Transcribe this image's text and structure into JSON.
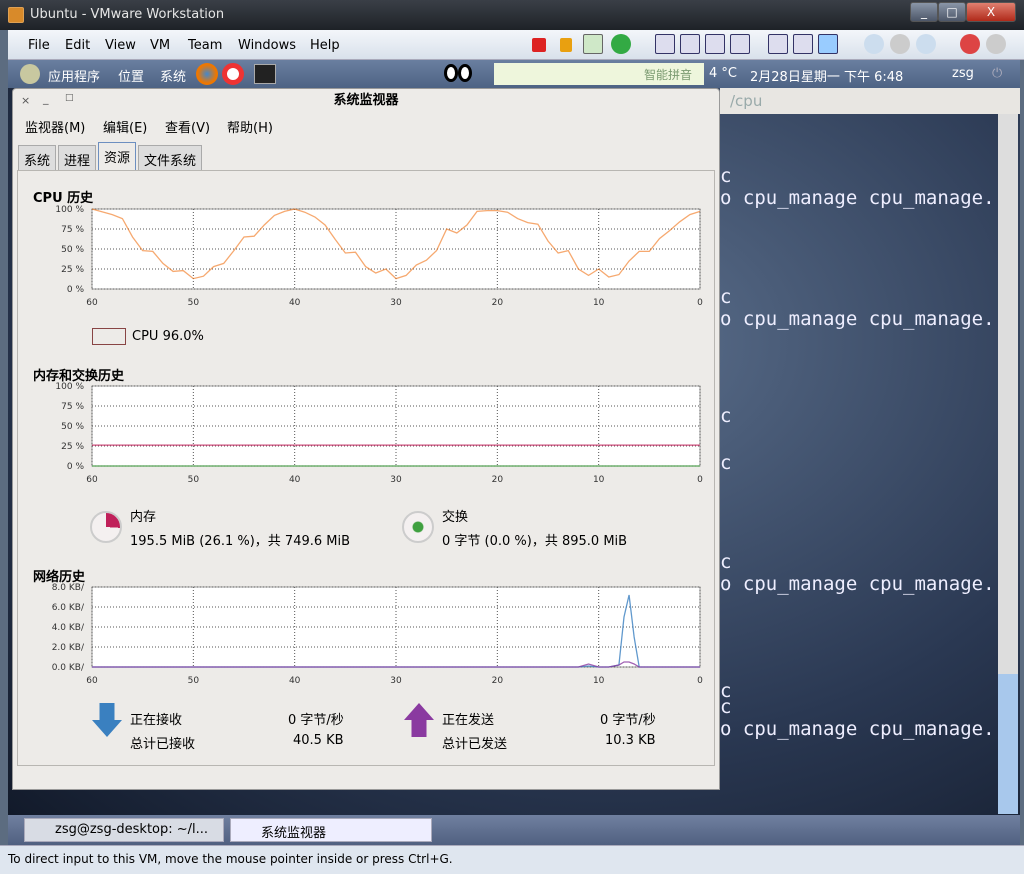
{
  "window": {
    "title": "Ubuntu - VMware Workstation",
    "buttons": [
      "_",
      "□",
      "X"
    ]
  },
  "menu": [
    "File",
    "Edit",
    "View",
    "VM",
    "Team",
    "Windows",
    "Help"
  ],
  "panel": {
    "apps": "应用程序",
    "places": "位置",
    "system": "系统",
    "ime": [
      "智能拼音"
    ],
    "weather": "4 °C",
    "datetime": "2月28日星期一 下午 6:48",
    "user": "zsg"
  },
  "terminal": {
    "title": "/cpu",
    "lines": [
      "c",
      "o cpu_manage cpu_manage.",
      "c",
      "o cpu_manage cpu_manage.",
      "c",
      "c",
      "c",
      "o cpu_manage cpu_manage.",
      "c",
      "c",
      "o cpu_manage cpu_manage."
    ]
  },
  "monitor": {
    "title": "系统监视器",
    "controls": [
      "×",
      "_",
      "□"
    ],
    "menus": [
      "监视器(M)",
      "编辑(E)",
      "查看(V)",
      "帮助(H)"
    ],
    "tabs": [
      "系统",
      "进程",
      "资源",
      "文件系统"
    ],
    "active_tab": "资源",
    "cpu": {
      "heading": "CPU 历史",
      "legend": "CPU  96.0%",
      "color": "#f07010"
    },
    "mem": {
      "heading": "内存和交换历史",
      "mem_label": "内存",
      "mem_value": "195.5 MiB (26.1 %)，共 749.6 MiB",
      "swap_label": "交换",
      "swap_value": "0 字节 (0.0 %)，共 895.0 MiB",
      "mem_color": "#c0205a",
      "swap_color": "#40a040"
    },
    "net": {
      "heading": "网络历史",
      "rx_label": "正在接收",
      "rx_rate": "0 字节/秒",
      "rx_total_label": "总计已接收",
      "rx_total": "40.5 KB",
      "tx_label": "正在发送",
      "tx_rate": "0 字节/秒",
      "tx_total_label": "总计已发送",
      "tx_total": "10.3 KB",
      "rx_color": "#3a80c0",
      "tx_color": "#8a3aa0"
    }
  },
  "taskbar": [
    "zsg@zsg-desktop: ~/l...",
    "系统监视器"
  ],
  "status": "To direct input to this VM, move the mouse pointer inside or press Ctrl+G.",
  "chart_data": [
    {
      "type": "line",
      "title": "CPU 历史",
      "x": [
        60,
        58,
        57,
        56,
        55,
        54,
        53,
        52,
        51,
        50,
        49,
        48,
        47,
        46,
        45,
        44,
        43,
        42,
        41,
        40,
        39,
        38,
        37,
        36,
        35,
        34,
        33,
        32,
        31,
        30,
        29,
        28,
        27,
        26,
        25,
        24,
        23,
        22,
        21,
        20,
        19,
        18,
        17,
        16,
        15,
        14,
        13,
        12,
        11,
        10,
        9,
        8,
        7,
        6,
        5,
        4,
        3,
        2,
        1,
        0
      ],
      "series": [
        {
          "name": "CPU",
          "values": [
            100,
            93,
            88,
            65,
            48,
            47,
            32,
            22,
            23,
            13,
            16,
            28,
            32,
            48,
            65,
            66,
            80,
            92,
            97,
            100,
            96,
            90,
            80,
            62,
            45,
            46,
            28,
            20,
            25,
            13,
            17,
            30,
            36,
            48,
            75,
            70,
            80,
            97,
            98,
            98,
            96,
            88,
            83,
            81,
            60,
            45,
            48,
            25,
            17,
            25,
            15,
            18,
            35,
            47,
            47,
            63,
            73,
            84,
            93,
            97
          ]
        }
      ],
      "xticks": [
        "60 ",
        "50",
        "40",
        "30",
        "20",
        "10",
        "0"
      ],
      "yticks": [
        "0 %",
        "25 %",
        "50 %",
        "75 %",
        "100 %"
      ],
      "xlim": [
        60,
        0
      ],
      "ylim": [
        0,
        100
      ],
      "grid": true
    },
    {
      "type": "line",
      "title": "内存和交换历史",
      "x": [
        60,
        0
      ],
      "series": [
        {
          "name": "内存",
          "values": [
            26.1,
            26.1
          ]
        },
        {
          "name": "交换",
          "values": [
            0,
            0
          ]
        }
      ],
      "xticks": [
        "60 ",
        "50",
        "40",
        "30",
        "20",
        "10",
        "0"
      ],
      "yticks": [
        "0 %",
        "25 %",
        "50 %",
        "75 %",
        "100 %"
      ],
      "xlim": [
        60,
        0
      ],
      "ylim": [
        0,
        100
      ],
      "grid": true
    },
    {
      "type": "line",
      "title": "网络历史",
      "x": [
        60,
        12,
        11,
        10,
        9,
        8,
        7.5,
        7,
        6.5,
        6,
        0
      ],
      "series": [
        {
          "name": "正在接收",
          "values": [
            0,
            0,
            0.1,
            0,
            0,
            0.2,
            5,
            7.2,
            3,
            0,
            0
          ]
        },
        {
          "name": "正在发送",
          "values": [
            0,
            0,
            0.3,
            0,
            0,
            0.2,
            0.5,
            0.5,
            0.3,
            0,
            0
          ]
        }
      ],
      "xticks": [
        "60 ",
        "50",
        "40",
        "30",
        "20",
        "10",
        "0"
      ],
      "yticks": [
        "0.0 KB/ ",
        "2.0 KB/ ",
        "4.0 KB/ ",
        "6.0 KB/ ",
        "8.0 KB/ "
      ],
      "xlim": [
        60,
        0
      ],
      "ylim": [
        0,
        8
      ],
      "grid": true
    }
  ]
}
